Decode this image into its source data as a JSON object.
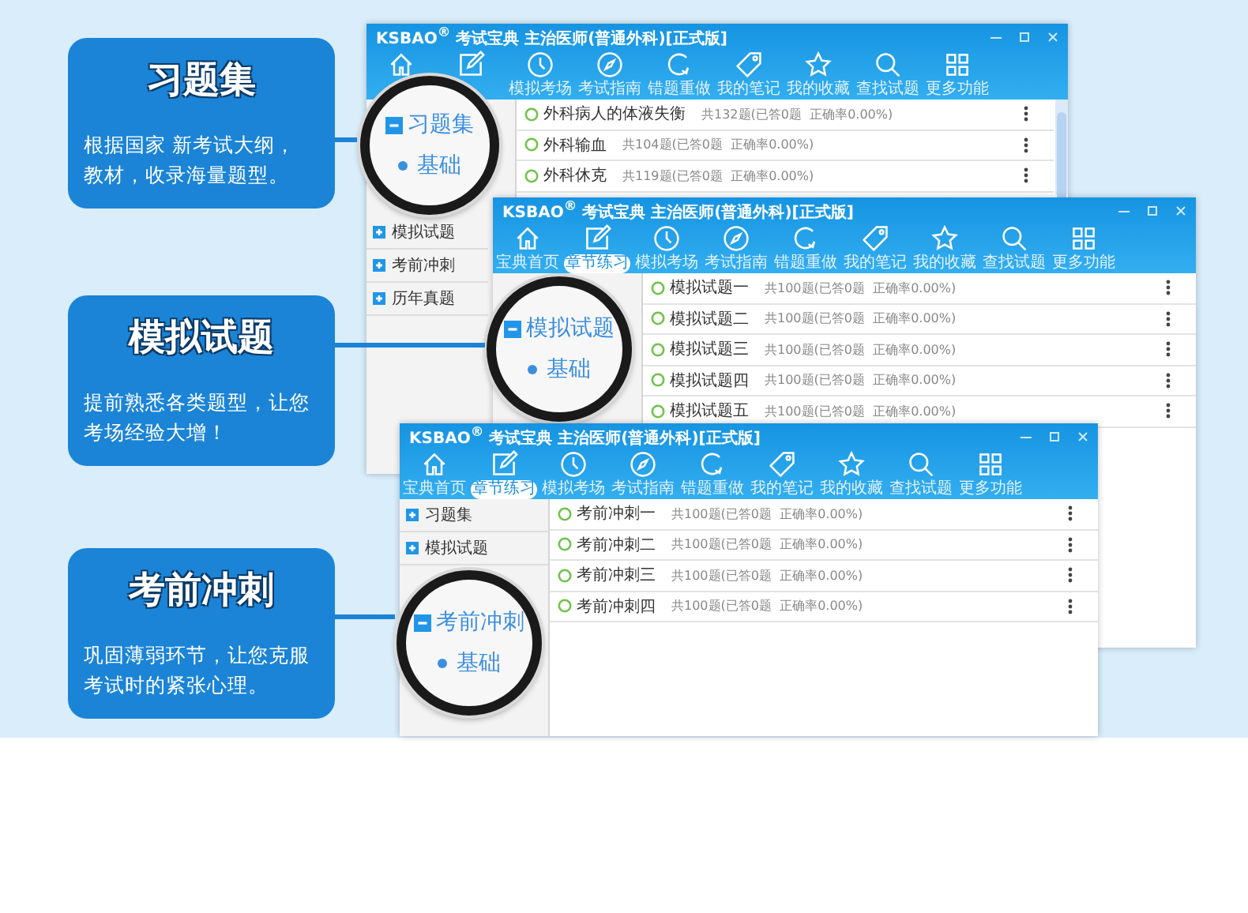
{
  "cards": [
    {
      "title": "习题集",
      "description": [
        "根据国家 新考试大纲，",
        "教材，收录海量题型。"
      ]
    },
    {
      "title": "模拟试题",
      "description": [
        "提前熟悉各类题型，让您",
        "考场经验大增！"
      ]
    },
    {
      "title": "考前冲刺",
      "description": [
        "巩固薄弱环节，让您克服",
        "考试时的紧张心理。"
      ]
    }
  ],
  "windows": [
    {
      "title": "KSBAO$^{®}$ 考试宝典  主治医师(普通外科)[正式版]",
      "toolbar": [
        {
          "kind": "home"
        },
        {
          "kind": "edit"
        },
        {
          "kind": "clock",
          "label": "模拟考场",
          "selected": false
        },
        {
          "kind": "compass",
          "label": "考试指南",
          "selected": false
        },
        {
          "kind": "refresh",
          "label": "错题重做",
          "selected": false
        },
        {
          "kind": "tag",
          "label": "我的笔记",
          "selected": false
        },
        {
          "kind": "star",
          "label": "我的收藏",
          "selected": false
        },
        {
          "kind": "search",
          "label": "查找试题",
          "selected": false
        },
        {
          "kind": "grid",
          "label": "更多功能",
          "selected": false
        }
      ],
      "sidebar": [
        {
          "label": "模拟试题",
          "expanded": false
        },
        {
          "label": "考前冲刺",
          "expanded": false
        },
        {
          "label": "历年真题",
          "expanded": false
        }
      ],
      "rows": [
        {
          "name": "外科病人的体液失衡",
          "info": "共132题(已答0题  正确率0.00%)"
        },
        {
          "name": "外科输血",
          "info": "共104题(已答0题  正确率0.00%)"
        },
        {
          "name": "外科休克",
          "info": "共119题(已答0题  正确率0.00%)"
        }
      ],
      "magnifier": {
        "label": "习题集",
        "expanded": true,
        "child": "基础"
      }
    },
    {
      "title": "KSBAO$^{®}$ 考试宝典  主治医师(普通外科)[正式版]",
      "toolbar": [
        {
          "kind": "home",
          "label": "宝典首页",
          "selected": false
        },
        {
          "kind": "edit",
          "label": "章节练习",
          "selected": true
        },
        {
          "kind": "clock",
          "label": "模拟考场",
          "selected": false
        },
        {
          "kind": "compass",
          "label": "考试指南",
          "selected": false
        },
        {
          "kind": "refresh",
          "label": "错题重做",
          "selected": false
        },
        {
          "kind": "tag",
          "label": "我的笔记",
          "selected": false
        },
        {
          "kind": "star",
          "label": "我的收藏",
          "selected": false
        },
        {
          "kind": "search",
          "label": "查找试题",
          "selected": false
        },
        {
          "kind": "grid",
          "label": "更多功能",
          "selected": false
        }
      ],
      "rows": [
        {
          "name": "模拟试题一",
          "info": "共100题(已答0题  正确率0.00%)"
        },
        {
          "name": "模拟试题二",
          "info": "共100题(已答0题  正确率0.00%)"
        },
        {
          "name": "模拟试题三",
          "info": "共100题(已答0题  正确率0.00%)"
        },
        {
          "name": "模拟试题四",
          "info": "共100题(已答0题  正确率0.00%)"
        },
        {
          "name": "模拟试题五",
          "info": "共100题(已答0题  正确率0.00%)"
        }
      ],
      "magnifier": {
        "label": "模拟试题",
        "expanded": true,
        "child": "基础"
      }
    },
    {
      "title": "KSBAO$^{®}$ 考试宝典  主治医师(普通外科)[正式版]",
      "toolbar": [
        {
          "kind": "home",
          "label": "宝典首页",
          "selected": false
        },
        {
          "kind": "edit",
          "label": "章节练习",
          "selected": true
        },
        {
          "kind": "clock",
          "label": "模拟考场",
          "selected": false
        },
        {
          "kind": "compass",
          "label": "考试指南",
          "selected": false
        },
        {
          "kind": "refresh",
          "label": "错题重做",
          "selected": false
        },
        {
          "kind": "tag",
          "label": "我的笔记",
          "selected": false
        },
        {
          "kind": "star",
          "label": "我的收藏",
          "selected": false
        },
        {
          "kind": "search",
          "label": "查找试题",
          "selected": false
        },
        {
          "kind": "grid",
          "label": "更多功能",
          "selected": false
        }
      ],
      "sidebar": [
        {
          "label": "习题集",
          "expanded": false
        },
        {
          "label": "模拟试题",
          "expanded": false
        }
      ],
      "rows": [
        {
          "name": "考前冲刺一",
          "info": "共100题(已答0题  正确率0.00%)"
        },
        {
          "name": "考前冲刺二",
          "info": "共100题(已答0题  正确率0.00%)"
        },
        {
          "name": "考前冲刺三",
          "info": "共100题(已答0题  正确率0.00%)"
        },
        {
          "name": "考前冲刺四",
          "info": "共100题(已答0题  正确率0.00%)"
        }
      ],
      "magnifier": {
        "label": "考前冲刺",
        "expanded": true,
        "child": "基础"
      }
    }
  ]
}
